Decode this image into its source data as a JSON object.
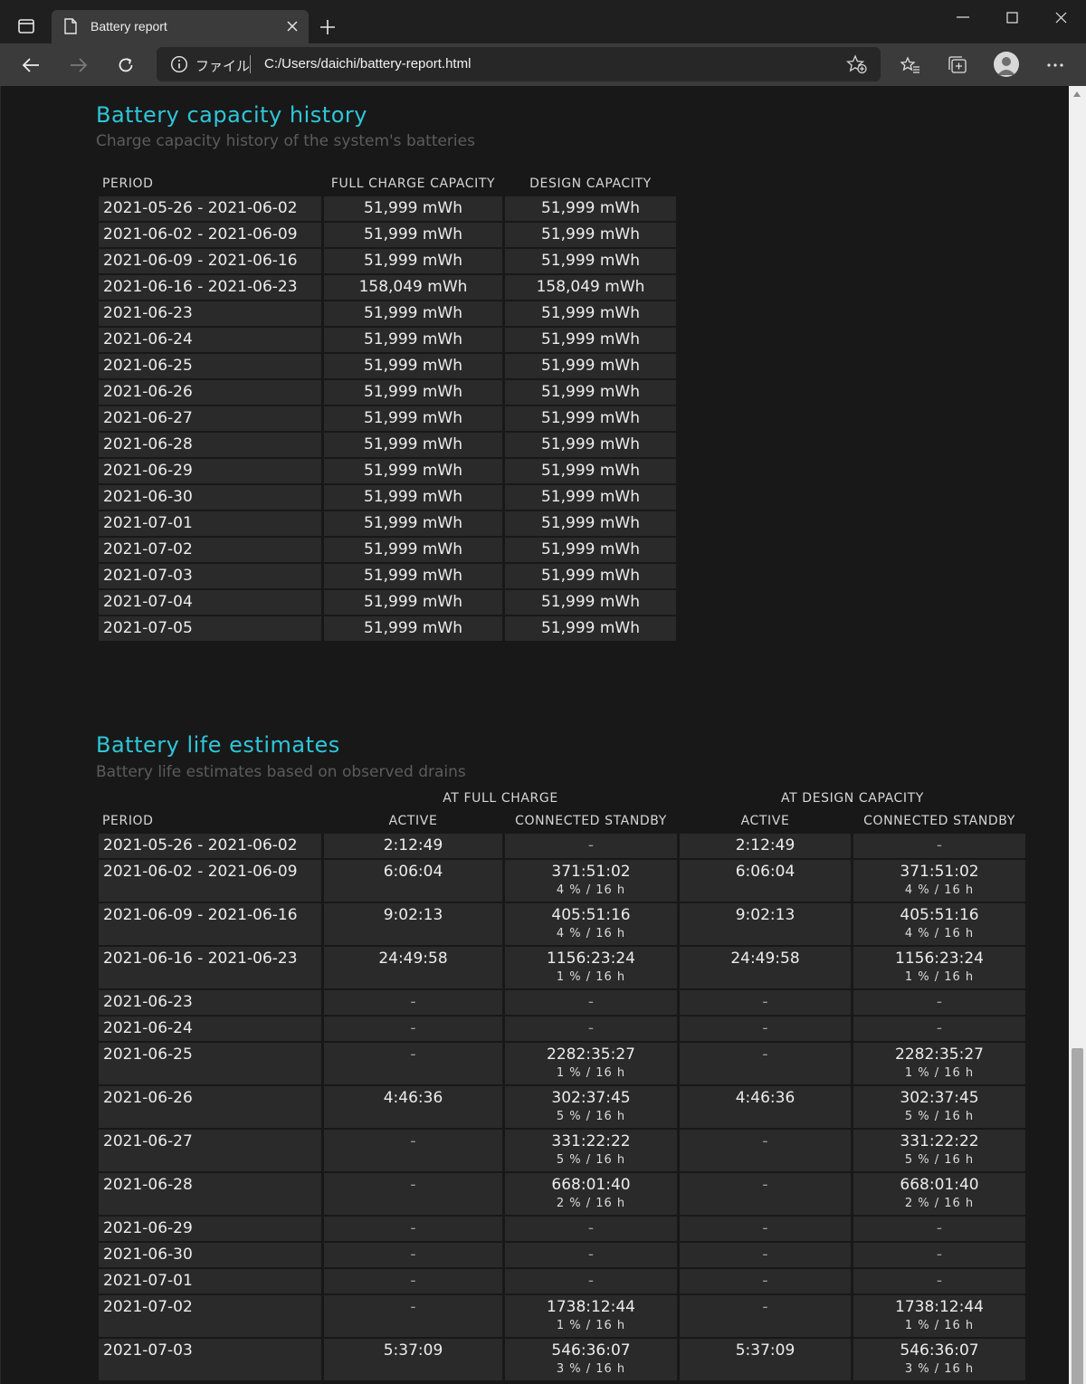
{
  "browser": {
    "tab_title": "Battery report",
    "scheme_label": "ファイル",
    "url": "C:/Users/daichi/battery-report.html"
  },
  "capacity_history": {
    "title": "Battery capacity history",
    "subtitle": "Charge capacity history of the system's batteries",
    "headers": [
      "PERIOD",
      "FULL CHARGE CAPACITY",
      "DESIGN CAPACITY"
    ],
    "rows": [
      {
        "period": "2021-05-26 - 2021-06-02",
        "full": "51,999 mWh",
        "design": "51,999 mWh"
      },
      {
        "period": "2021-06-02 - 2021-06-09",
        "full": "51,999 mWh",
        "design": "51,999 mWh"
      },
      {
        "period": "2021-06-09 - 2021-06-16",
        "full": "51,999 mWh",
        "design": "51,999 mWh"
      },
      {
        "period": "2021-06-16 - 2021-06-23",
        "full": "158,049 mWh",
        "design": "158,049 mWh"
      },
      {
        "period": "2021-06-23",
        "full": "51,999 mWh",
        "design": "51,999 mWh"
      },
      {
        "period": "2021-06-24",
        "full": "51,999 mWh",
        "design": "51,999 mWh"
      },
      {
        "period": "2021-06-25",
        "full": "51,999 mWh",
        "design": "51,999 mWh"
      },
      {
        "period": "2021-06-26",
        "full": "51,999 mWh",
        "design": "51,999 mWh"
      },
      {
        "period": "2021-06-27",
        "full": "51,999 mWh",
        "design": "51,999 mWh"
      },
      {
        "period": "2021-06-28",
        "full": "51,999 mWh",
        "design": "51,999 mWh"
      },
      {
        "period": "2021-06-29",
        "full": "51,999 mWh",
        "design": "51,999 mWh"
      },
      {
        "period": "2021-06-30",
        "full": "51,999 mWh",
        "design": "51,999 mWh"
      },
      {
        "period": "2021-07-01",
        "full": "51,999 mWh",
        "design": "51,999 mWh"
      },
      {
        "period": "2021-07-02",
        "full": "51,999 mWh",
        "design": "51,999 mWh"
      },
      {
        "period": "2021-07-03",
        "full": "51,999 mWh",
        "design": "51,999 mWh"
      },
      {
        "period": "2021-07-04",
        "full": "51,999 mWh",
        "design": "51,999 mWh"
      },
      {
        "period": "2021-07-05",
        "full": "51,999 mWh",
        "design": "51,999 mWh"
      }
    ]
  },
  "life_estimates": {
    "title": "Battery life estimates",
    "subtitle": "Battery life estimates based on observed drains",
    "group_headers": [
      "AT FULL CHARGE",
      "AT DESIGN CAPACITY"
    ],
    "headers": [
      "PERIOD",
      "ACTIVE",
      "CONNECTED STANDBY",
      "ACTIVE",
      "CONNECTED STANDBY"
    ],
    "rows": [
      {
        "period": "2021-05-26 - 2021-06-02",
        "fc_active": "2:12:49",
        "fc_standby": "-",
        "fc_standby_sub": "",
        "dc_active": "2:12:49",
        "dc_standby": "-",
        "dc_standby_sub": ""
      },
      {
        "period": "2021-06-02 - 2021-06-09",
        "fc_active": "6:06:04",
        "fc_standby": "371:51:02",
        "fc_standby_sub": "4 % / 16 h",
        "dc_active": "6:06:04",
        "dc_standby": "371:51:02",
        "dc_standby_sub": "4 % / 16 h"
      },
      {
        "period": "2021-06-09 - 2021-06-16",
        "fc_active": "9:02:13",
        "fc_standby": "405:51:16",
        "fc_standby_sub": "4 % / 16 h",
        "dc_active": "9:02:13",
        "dc_standby": "405:51:16",
        "dc_standby_sub": "4 % / 16 h"
      },
      {
        "period": "2021-06-16 - 2021-06-23",
        "fc_active": "24:49:58",
        "fc_standby": "1156:23:24",
        "fc_standby_sub": "1 % / 16 h",
        "dc_active": "24:49:58",
        "dc_standby": "1156:23:24",
        "dc_standby_sub": "1 % / 16 h"
      },
      {
        "period": "2021-06-23",
        "fc_active": "-",
        "fc_standby": "-",
        "fc_standby_sub": "",
        "dc_active": "-",
        "dc_standby": "-",
        "dc_standby_sub": ""
      },
      {
        "period": "2021-06-24",
        "fc_active": "-",
        "fc_standby": "-",
        "fc_standby_sub": "",
        "dc_active": "-",
        "dc_standby": "-",
        "dc_standby_sub": ""
      },
      {
        "period": "2021-06-25",
        "fc_active": "-",
        "fc_standby": "2282:35:27",
        "fc_standby_sub": "1 % / 16 h",
        "dc_active": "-",
        "dc_standby": "2282:35:27",
        "dc_standby_sub": "1 % / 16 h"
      },
      {
        "period": "2021-06-26",
        "fc_active": "4:46:36",
        "fc_standby": "302:37:45",
        "fc_standby_sub": "5 % / 16 h",
        "dc_active": "4:46:36",
        "dc_standby": "302:37:45",
        "dc_standby_sub": "5 % / 16 h"
      },
      {
        "period": "2021-06-27",
        "fc_active": "-",
        "fc_standby": "331:22:22",
        "fc_standby_sub": "5 % / 16 h",
        "dc_active": "-",
        "dc_standby": "331:22:22",
        "dc_standby_sub": "5 % / 16 h"
      },
      {
        "period": "2021-06-28",
        "fc_active": "-",
        "fc_standby": "668:01:40",
        "fc_standby_sub": "2 % / 16 h",
        "dc_active": "-",
        "dc_standby": "668:01:40",
        "dc_standby_sub": "2 % / 16 h"
      },
      {
        "period": "2021-06-29",
        "fc_active": "-",
        "fc_standby": "-",
        "fc_standby_sub": "",
        "dc_active": "-",
        "dc_standby": "-",
        "dc_standby_sub": ""
      },
      {
        "period": "2021-06-30",
        "fc_active": "-",
        "fc_standby": "-",
        "fc_standby_sub": "",
        "dc_active": "-",
        "dc_standby": "-",
        "dc_standby_sub": ""
      },
      {
        "period": "2021-07-01",
        "fc_active": "-",
        "fc_standby": "-",
        "fc_standby_sub": "",
        "dc_active": "-",
        "dc_standby": "-",
        "dc_standby_sub": ""
      },
      {
        "period": "2021-07-02",
        "fc_active": "-",
        "fc_standby": "1738:12:44",
        "fc_standby_sub": "1 % / 16 h",
        "dc_active": "-",
        "dc_standby": "1738:12:44",
        "dc_standby_sub": "1 % / 16 h"
      },
      {
        "period": "2021-07-03",
        "fc_active": "5:37:09",
        "fc_standby": "546:36:07",
        "fc_standby_sub": "3 % / 16 h",
        "dc_active": "5:37:09",
        "dc_standby": "546:36:07",
        "dc_standby_sub": "3 % / 16 h"
      }
    ]
  },
  "colors": {
    "accent": "#2ec6d8",
    "page_bg": "#181818",
    "cell_bg": "#2a2a2a",
    "chrome_bg": "#3b3b3b"
  },
  "icons": {
    "tab_actions": "tab-actions-icon",
    "page": "page-icon",
    "close": "close-icon",
    "new_tab": "plus-icon",
    "minimize": "minimize-icon",
    "maximize": "maximize-icon",
    "window_close": "window-close-icon",
    "back": "back-arrow-icon",
    "forward": "forward-arrow-icon",
    "refresh": "refresh-icon",
    "info": "info-icon",
    "add_favorite": "add-favorite-icon",
    "favorites": "favorites-icon",
    "collections": "collections-icon",
    "profile": "profile-avatar-icon",
    "more": "more-icon"
  }
}
